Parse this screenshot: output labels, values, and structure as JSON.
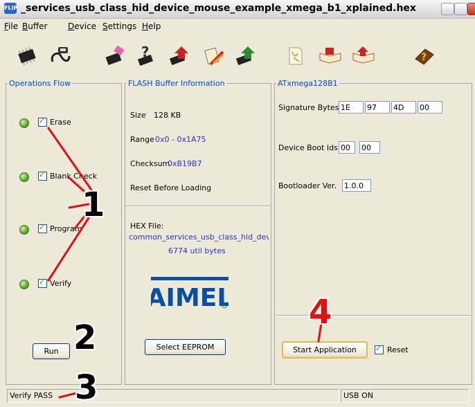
{
  "window": {
    "title": "_services_usb_class_hid_device_mouse_example_xmega_b1_xplained.hex",
    "app_icon_label": "FLIP"
  },
  "menu": {
    "items": [
      {
        "first": "F",
        "rest": "ile"
      },
      {
        "first": "B",
        "rest": "uffer"
      },
      {
        "first": "D",
        "rest": "evice"
      },
      {
        "first": "S",
        "rest": "ettings"
      },
      {
        "first": "H",
        "rest": "elp"
      }
    ]
  },
  "toolbar": {
    "icons": [
      "chip-select-icon",
      "usb-cable-icon",
      "erase-icon",
      "query-icon",
      "load-hex-icon",
      "edit-buffer-icon",
      "program-icon",
      "document-icon",
      "book-read-icon",
      "book-write-icon",
      "help-book-icon"
    ]
  },
  "operations_flow": {
    "legend": "Operations Flow",
    "steps": [
      "Erase",
      "Blank Check",
      "Program",
      "Verify"
    ],
    "run_label": "Run"
  },
  "flash_buffer": {
    "legend": "FLASH Buffer Information",
    "size_label": "Size",
    "size_value": "128 KB",
    "range_label": "Range",
    "range_value": "0x0 - 0x1A75",
    "checksum_label": "Checksum",
    "checksum_value": "0xB19B7",
    "reset_label": "Reset Before Loading",
    "hex_file_label": "HEX File:",
    "hex_file_name": "common_services_usb_class_hid_dev",
    "hex_file_bytes": "6774 util bytes",
    "logo_text": "AIMEL",
    "select_eeprom_label": "Select EEPROM"
  },
  "device": {
    "legend": "ATxmega128B1",
    "signature_label": "Signature Bytes",
    "signature_bytes": [
      "1E",
      "97",
      "4D",
      "00"
    ],
    "boot_ids_label": "Device Boot Ids",
    "boot_ids": [
      "00",
      "00"
    ],
    "bootloader_label": "Bootloader Ver.",
    "bootloader_value": "1.0.0",
    "start_app_label": "Start Application",
    "reset_label": "Reset"
  },
  "status": {
    "left": "Verify PASS",
    "right": "USB ON"
  },
  "annotations": [
    "1",
    "2",
    "3",
    "4"
  ],
  "colors": {
    "accent_blue": "#0046d5",
    "value_blue": "#2233cc",
    "annotation_red": "#e01010",
    "led_green": "#5fae2b"
  }
}
